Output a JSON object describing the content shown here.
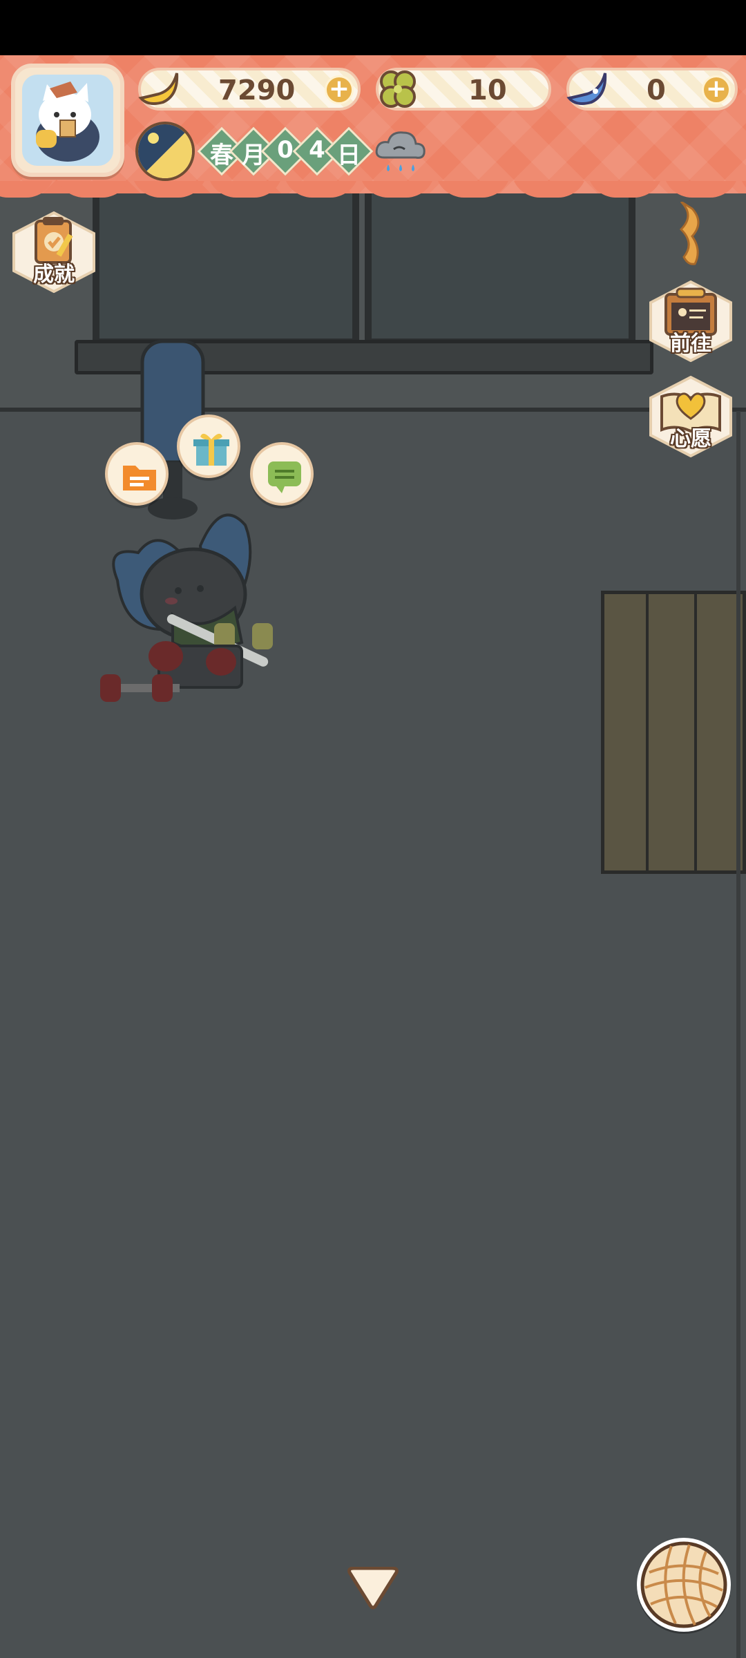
{
  "header": {
    "bananas": "7290",
    "clovers": "10",
    "blue_bananas": "0",
    "calendar": {
      "season": "春",
      "month_label": "月",
      "day_digit_1": "0",
      "day_digit_2": "4",
      "day_label": "日"
    },
    "weather": "rain-cloud-icon"
  },
  "side_buttons": {
    "achievements": "成就",
    "goto": "前往",
    "wish": "心愿"
  },
  "bubbles": [
    "folder-icon",
    "gift-icon",
    "chat-icon"
  ],
  "colors": {
    "banner": "#ee8266",
    "floor": "#4b5052",
    "accent_gold": "#e8b24b",
    "diamond_green": "#6aa07b"
  }
}
